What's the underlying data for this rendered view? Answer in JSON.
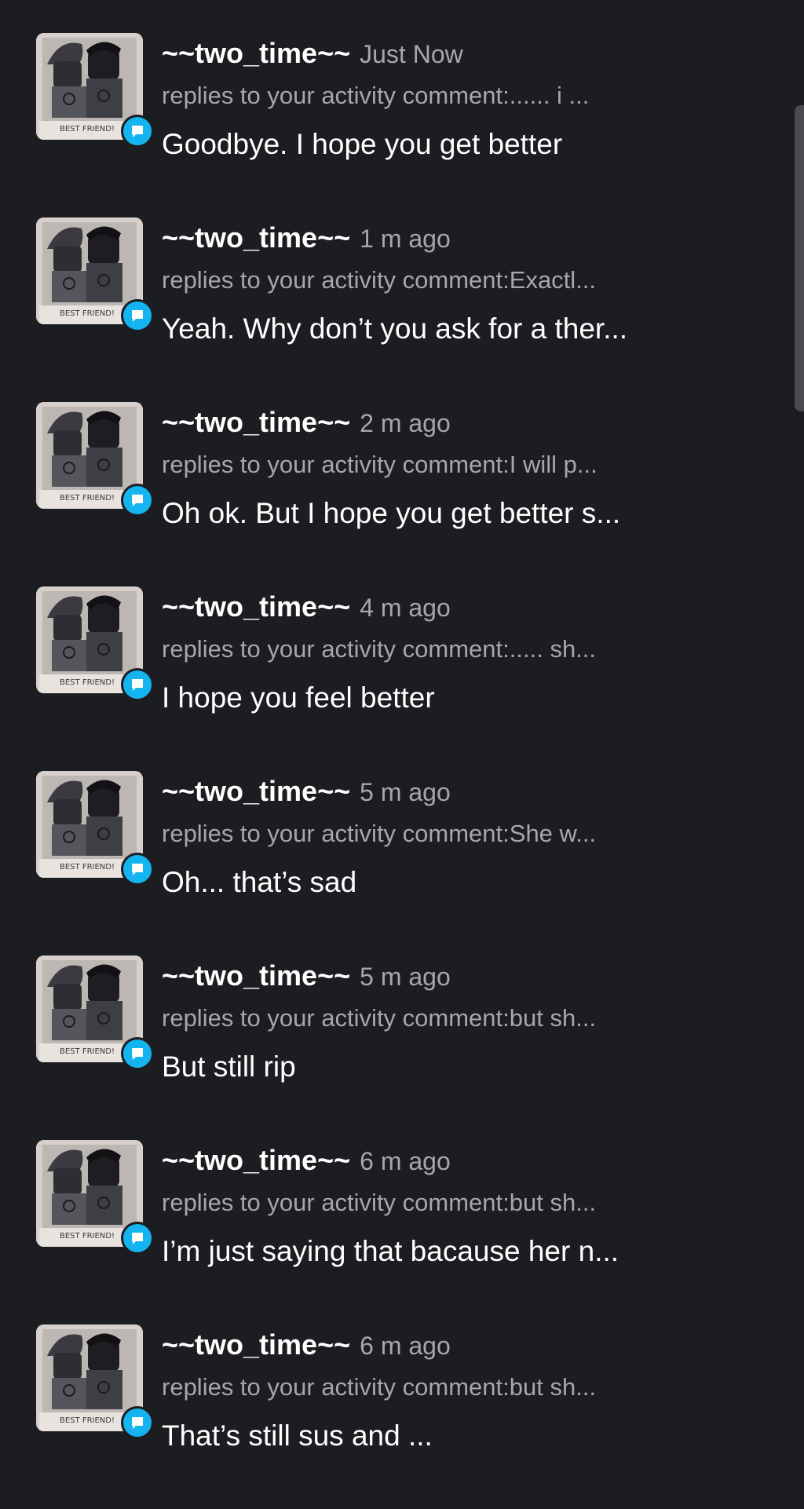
{
  "notifications": [
    {
      "username": "~~two_time~~",
      "time": "Just Now",
      "context": "replies to your activity comment:...... i ...",
      "message": "Goodbye. I hope you get better"
    },
    {
      "username": "~~two_time~~",
      "time": "1 m ago",
      "context": "replies to your activity comment:Exactl...",
      "message": "Yeah. Why don’t you ask for a ther..."
    },
    {
      "username": "~~two_time~~",
      "time": "2 m ago",
      "context": "replies to your activity comment:I will p...",
      "message": "Oh ok. But I hope you get better s..."
    },
    {
      "username": "~~two_time~~",
      "time": "4 m ago",
      "context": "replies to your activity comment:..... sh...",
      "message": "I hope you feel better"
    },
    {
      "username": "~~two_time~~",
      "time": "5 m ago",
      "context": "replies to your activity comment:She w...",
      "message": "Oh... that’s sad"
    },
    {
      "username": "~~two_time~~",
      "time": "5 m ago",
      "context": "replies to your activity comment:but sh...",
      "message": "But still rip"
    },
    {
      "username": "~~two_time~~",
      "time": "6 m ago",
      "context": "replies to your activity comment:but sh...",
      "message": "I’m just saying that bacause her n..."
    },
    {
      "username": "~~two_time~~",
      "time": "6 m ago",
      "context": "replies to your activity comment:but sh...",
      "message": "That’s still sus and ..."
    }
  ],
  "avatar_caption": "BEST FRIEND!",
  "badge_icon": "comment-bubble-icon",
  "colors": {
    "background": "#1c1d21",
    "secondary_text": "#a6a7ab",
    "badge": "#14b4f0"
  }
}
